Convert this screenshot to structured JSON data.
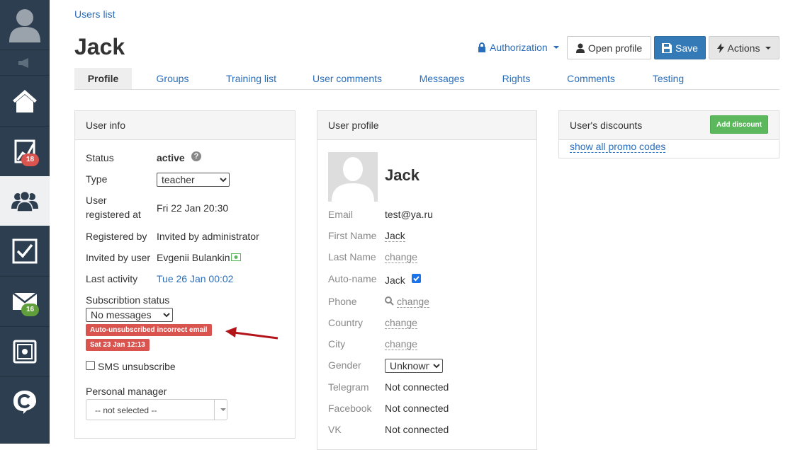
{
  "sidebar": {
    "badges": {
      "stats": "18",
      "messages": "16"
    },
    "colors": {
      "bg": "#2d3e50",
      "active_bg": "#eef0f2",
      "badge_red": "#d9534f",
      "badge_green": "#5f9e3a"
    }
  },
  "breadcrumb": "Users list",
  "page_title": "Jack",
  "header": {
    "authorization": "Authorization",
    "open_profile": "Open profile",
    "save": "Save",
    "actions": "Actions"
  },
  "tabs": [
    "Profile",
    "Groups",
    "Training list",
    "User comments",
    "Messages",
    "Rights",
    "Comments",
    "Testing"
  ],
  "user_info": {
    "heading": "User info",
    "status_label": "Status",
    "status_value": "active",
    "type_label": "Type",
    "type_value": "teacher",
    "registered_label_1": "User",
    "registered_label_2": "registered at",
    "registered_value": "Fri 22 Jan 20:30",
    "registered_by_label": "Registered by",
    "registered_by_value": "Invited by administrator",
    "invited_by_label": "Invited by user",
    "invited_by_value": "Evgenii Bulankin",
    "last_activity_label": "Last activity",
    "last_activity_value": "Tue 26 Jan 00:02",
    "subscription_label": "Subscribtion status",
    "subscription_value": "No messages",
    "auto_unsub_tag": "Auto-unsubscribed incorrect email",
    "auto_unsub_date": "Sat 23 Jan 12:13",
    "sms_label": "SMS unsubscribe",
    "manager_label": "Personal manager",
    "manager_value": "-- not selected --"
  },
  "user_profile": {
    "heading": "User profile",
    "name": "Jack",
    "email_label": "Email",
    "email_value": "test@ya.ru",
    "first_name_label": "First Name",
    "first_name_value": "Jack",
    "last_name_label": "Last Name",
    "change": "change",
    "auto_name_label": "Auto-name",
    "auto_name_value": "Jack",
    "phone_label": "Phone",
    "country_label": "Country",
    "city_label": "City",
    "gender_label": "Gender",
    "gender_value": "Unknown",
    "telegram_label": "Telegram",
    "telegram_value": "Not connected",
    "facebook_label": "Facebook",
    "facebook_value": "Not connected",
    "vk_label": "VK",
    "vk_value": "Not connected"
  },
  "discounts": {
    "heading": "User's discounts",
    "add_button": "Add discount",
    "promo_link": "show all promo codes"
  },
  "colors": {
    "link": "#2a6ebb",
    "primary": "#337ab7",
    "success": "#5cb85c",
    "danger": "#d9534f",
    "annotation_arrow": "#b3141a"
  }
}
